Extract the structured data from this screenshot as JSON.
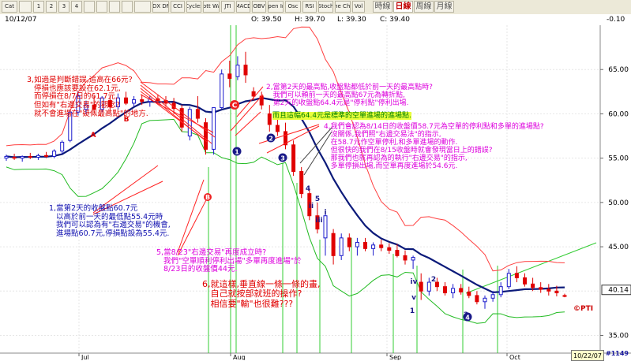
{
  "toolbar": {
    "buttons": [
      "Cat",
      "",
      "1",
      "2",
      "3",
      "4",
      "",
      "",
      "",
      "",
      "",
      "ADX DMI",
      "CCI",
      "Cycles",
      "Elliott Wave",
      "JTI",
      "MACD",
      "OBV",
      "Open Int",
      "Osc",
      "RSI",
      "Stoch",
      "Time Chart",
      "Vol"
    ],
    "periods": [
      "時線",
      "日線",
      "周線",
      "月線"
    ],
    "active_period": "日線"
  },
  "info": {
    "date": "10/12/07",
    "open": "O: 39.50",
    "high": "H: 39.70",
    "low": "L: 39.30",
    "close": "C: 39.40",
    "change": "-0.10"
  },
  "chart_data": {
    "type": "candlestick",
    "y_axis_ticks": [
      "65.00",
      "60.00",
      "55.00",
      "50.00",
      "45.00",
      "35.00"
    ],
    "last_price_label": "40.14",
    "x_axis_labels": [
      "Jul",
      "Aug",
      "Sep",
      "Oct"
    ],
    "ylim": [
      33,
      70
    ],
    "candles": [
      {
        "o": 55.0,
        "h": 55.4,
        "l": 54.7,
        "c": 55.2
      },
      {
        "o": 55.1,
        "h": 55.5,
        "l": 54.8,
        "c": 55.0
      },
      {
        "o": 55.0,
        "h": 55.3,
        "l": 54.6,
        "c": 55.2
      },
      {
        "o": 55.2,
        "h": 55.6,
        "l": 54.9,
        "c": 55.1
      },
      {
        "o": 55.1,
        "h": 55.5,
        "l": 54.8,
        "c": 55.3
      },
      {
        "o": 55.3,
        "h": 55.7,
        "l": 55.0,
        "c": 55.2
      },
      {
        "o": 55.2,
        "h": 56.0,
        "l": 55.0,
        "c": 55.8
      },
      {
        "o": 55.8,
        "h": 57.0,
        "l": 55.5,
        "c": 56.8
      },
      {
        "o": 57.0,
        "h": 60.5,
        "l": 56.8,
        "c": 60.2
      },
      {
        "o": 60.2,
        "h": 62.5,
        "l": 59.8,
        "c": 62.0
      },
      {
        "o": 60.5,
        "h": 61.5,
        "l": 60.0,
        "c": 61.0
      },
      {
        "o": 61.0,
        "h": 62.0,
        "l": 60.0,
        "c": 60.5
      },
      {
        "o": 60.5,
        "h": 62.0,
        "l": 60.2,
        "c": 61.8
      },
      {
        "o": 61.5,
        "h": 62.0,
        "l": 60.3,
        "c": 60.8
      },
      {
        "o": 60.8,
        "h": 62.3,
        "l": 60.5,
        "c": 61.8
      },
      {
        "o": 61.8,
        "h": 62.5,
        "l": 61.0,
        "c": 61.2
      },
      {
        "o": 61.2,
        "h": 62.0,
        "l": 60.8,
        "c": 61.6
      },
      {
        "o": 61.6,
        "h": 62.2,
        "l": 61.0,
        "c": 61.4
      },
      {
        "o": 61.4,
        "h": 62.0,
        "l": 60.8,
        "c": 61.7
      },
      {
        "o": 61.7,
        "h": 62.2,
        "l": 61.2,
        "c": 61.5
      },
      {
        "o": 61.5,
        "h": 62.0,
        "l": 60.8,
        "c": 61.2
      },
      {
        "o": 61.2,
        "h": 61.8,
        "l": 60.0,
        "c": 60.6
      },
      {
        "o": 60.6,
        "h": 61.0,
        "l": 58.0,
        "c": 58.5
      },
      {
        "o": 57.5,
        "h": 60.8,
        "l": 57.0,
        "c": 60.5
      },
      {
        "o": 60.5,
        "h": 62.0,
        "l": 59.0,
        "c": 59.5
      },
      {
        "o": 59.0,
        "h": 59.5,
        "l": 55.4,
        "c": 56.0
      },
      {
        "o": 56.0,
        "h": 60.7,
        "l": 55.4,
        "c": 60.7
      },
      {
        "o": 60.7,
        "h": 65.0,
        "l": 60.5,
        "c": 64.5
      },
      {
        "o": 64.5,
        "h": 66.0,
        "l": 63.0,
        "c": 64.0
      },
      {
        "o": 64.2,
        "h": 66.5,
        "l": 63.8,
        "c": 65.5
      },
      {
        "o": 65.5,
        "h": 67.0,
        "l": 63.5,
        "c": 64.4
      },
      {
        "o": 62.5,
        "h": 63.0,
        "l": 61.5,
        "c": 62.0
      },
      {
        "o": 62.0,
        "h": 62.5,
        "l": 60.5,
        "c": 61.0
      },
      {
        "o": 60.0,
        "h": 61.0,
        "l": 58.0,
        "c": 58.8
      },
      {
        "o": 58.7,
        "h": 59.5,
        "l": 57.5,
        "c": 58.0
      },
      {
        "o": 58.0,
        "h": 59.0,
        "l": 56.0,
        "c": 56.5
      },
      {
        "o": 56.5,
        "h": 57.0,
        "l": 53.0,
        "c": 53.5
      },
      {
        "o": 53.5,
        "h": 54.0,
        "l": 50.5,
        "c": 51.0
      },
      {
        "o": 51.0,
        "h": 51.5,
        "l": 48.0,
        "c": 48.5
      },
      {
        "o": 48.5,
        "h": 50.0,
        "l": 46.5,
        "c": 47.0
      },
      {
        "o": 46.0,
        "h": 49.0,
        "l": 44.0,
        "c": 48.5
      },
      {
        "o": 46.5,
        "h": 47.0,
        "l": 43.0,
        "c": 44.0
      },
      {
        "o": 44.0,
        "h": 46.5,
        "l": 43.5,
        "c": 46.0
      },
      {
        "o": 46.0,
        "h": 46.5,
        "l": 44.5,
        "c": 45.0
      },
      {
        "o": 45.0,
        "h": 46.0,
        "l": 44.0,
        "c": 45.5
      },
      {
        "o": 45.5,
        "h": 46.0,
        "l": 44.5,
        "c": 44.8
      },
      {
        "o": 44.8,
        "h": 45.5,
        "l": 44.0,
        "c": 45.2
      },
      {
        "o": 45.2,
        "h": 45.8,
        "l": 44.5,
        "c": 44.9
      },
      {
        "o": 44.9,
        "h": 45.4,
        "l": 44.2,
        "c": 44.6
      },
      {
        "o": 44.6,
        "h": 45.3,
        "l": 43.8,
        "c": 44.0
      },
      {
        "o": 44.0,
        "h": 44.6,
        "l": 43.0,
        "c": 43.5
      },
      {
        "o": 43.5,
        "h": 44.0,
        "l": 42.5,
        "c": 43.8
      },
      {
        "o": 41.0,
        "h": 42.0,
        "l": 39.0,
        "c": 40.0
      },
      {
        "o": 40.0,
        "h": 41.5,
        "l": 39.5,
        "c": 41.0
      },
      {
        "o": 41.0,
        "h": 41.5,
        "l": 40.0,
        "c": 40.5
      },
      {
        "o": 40.5,
        "h": 41.0,
        "l": 39.5,
        "c": 39.8
      },
      {
        "o": 39.8,
        "h": 40.8,
        "l": 39.2,
        "c": 40.3
      },
      {
        "o": 40.3,
        "h": 40.8,
        "l": 39.6,
        "c": 39.9
      },
      {
        "o": 39.9,
        "h": 40.5,
        "l": 39.2,
        "c": 39.5
      },
      {
        "o": 39.5,
        "h": 40.0,
        "l": 38.5,
        "c": 38.8
      },
      {
        "o": 38.8,
        "h": 39.5,
        "l": 38.0,
        "c": 39.2
      },
      {
        "o": 39.2,
        "h": 40.0,
        "l": 38.8,
        "c": 39.6
      },
      {
        "o": 39.6,
        "h": 41.0,
        "l": 39.3,
        "c": 40.5
      },
      {
        "o": 40.5,
        "h": 42.5,
        "l": 40.2,
        "c": 42.0
      },
      {
        "o": 42.0,
        "h": 42.8,
        "l": 41.0,
        "c": 41.5
      },
      {
        "o": 41.5,
        "h": 42.0,
        "l": 40.5,
        "c": 40.8
      },
      {
        "o": 40.8,
        "h": 41.5,
        "l": 40.0,
        "c": 40.4
      },
      {
        "o": 40.4,
        "h": 41.0,
        "l": 39.8,
        "c": 40.2
      },
      {
        "o": 40.2,
        "h": 40.8,
        "l": 39.5,
        "c": 40.0
      },
      {
        "o": 40.0,
        "h": 40.6,
        "l": 39.4,
        "c": 39.8
      },
      {
        "o": 39.5,
        "h": 39.7,
        "l": 39.3,
        "c": 39.4
      }
    ]
  },
  "chart_labels": {
    "waves": [
      "A",
      "B",
      "C",
      "1",
      "2",
      "3",
      "4",
      "5",
      "i",
      "ii",
      "iii",
      "iv",
      "v",
      "1",
      "2",
      "3",
      "4"
    ]
  },
  "annotations": {
    "a1": "1,當第2天的收盤點60.7元\n   以高於前一天的最低點55.4元時\n   我們可以認為有\"右邊交易\"的機會,\n   進場點60.7元,停損點設為55.4元.",
    "a2": "2,當第2天的最高點,收盤點都低於前一天的最高點時?\n   我們可以賴前一天的最高點67元為轉折點,\n   第2天的收盤點64.4元是\"停利點\"停利出場.",
    "a2b": "而且這幅64.4元是標準的空單進場的進場點.",
    "a3": "3,如過是判斷錯誤,追高在66元?\n   停損也應該要設在62.1元,\n   而停損在8/7日的61.7元,\n   但如有\"右邊交易\"的觀念?\n   就不會進場在\"疑似最高點\"的地方.",
    "a4": "4,我們會認為8/14日的收盤價58.7元為空單的停利點和多單的進場點?\n   沒關係,我們照\"右邊交易法\"的指示,\n   在58.7元作空單停利,和多單進場的動作.\n   但很快的我們在8/15收盤時就會發現當日上的錯誤?\n   那我們也就再認為的執行\"右邊交易\"的指示,\n   多單停損出場,而空單再度進場於54.6元.",
    "a5": "5,當8/23\"右邊交易\"再度成立時?\n   我們\"空單順利停利出場\"多單再度進場\"於\n   8/23日的收盤價44元.",
    "a6": "6,就這樣,垂直線一條一條的畫,\n   自己就按部就班的操作?\n   相信要\"輸\"也很難???"
  },
  "copyright": "©PTI",
  "footer": {
    "date": "10/22/07",
    "page": "#1149"
  }
}
